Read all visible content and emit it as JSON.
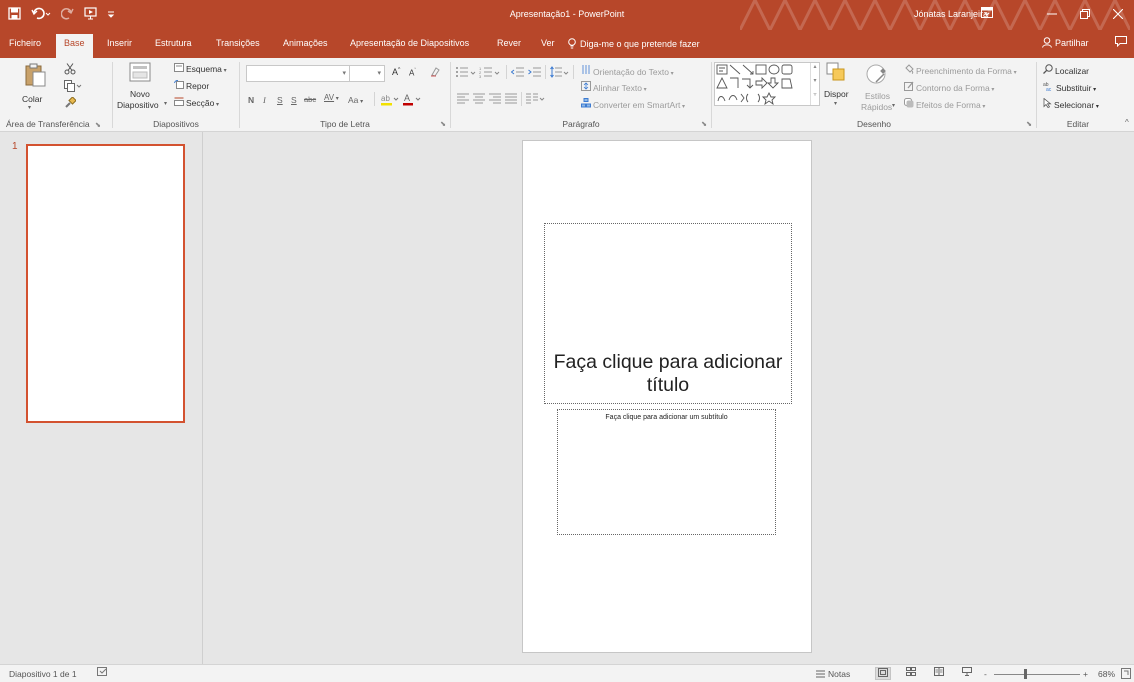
{
  "window": {
    "title": "Apresentação1 - PowerPoint",
    "user": "Jónatas Laranjeira",
    "icons": [
      "save-icon",
      "undo-icon",
      "redo-icon",
      "start-from-beginning-icon",
      "customize-qat-icon"
    ]
  },
  "tabs": [
    "Ficheiro",
    "Base",
    "Inserir",
    "Estrutura",
    "Transições",
    "Animações",
    "Apresentação de Diapositivos",
    "Rever",
    "Ver"
  ],
  "active_tab": "Base",
  "tell_me": "Diga-me o que pretende fazer",
  "share": "Partilhar",
  "ribbon": {
    "clipboard": {
      "label": "Área de Transferência",
      "paste": "Colar"
    },
    "slides": {
      "label": "Diapositivos",
      "new_slide_1": "Novo",
      "new_slide_2": "Diapositivo",
      "layout": "Esquema",
      "reset": "Repor",
      "section": "Secção"
    },
    "font": {
      "label": "Tipo de Letra",
      "font_name": "",
      "font_size": "",
      "bold": "N",
      "italic": "I",
      "underline": "S",
      "shadow": "S",
      "strike": "abc",
      "spacing": "AV",
      "case": "Aa",
      "grow": "A",
      "shrink": "A",
      "color": "A"
    },
    "paragraph": {
      "label": "Parágrafo",
      "text_direction": "Orientação do Texto",
      "align_text": "Alinhar Texto",
      "smartart": "Converter em SmartArt"
    },
    "drawing": {
      "label": "Desenho",
      "arrange": "Dispor",
      "quick_styles_1": "Estilos",
      "quick_styles_2": "Rápidos",
      "shape_fill": "Preenchimento da Forma",
      "shape_outline": "Contorno da Forma",
      "shape_effects": "Efeitos de Forma"
    },
    "editing": {
      "label": "Editar",
      "find": "Localizar",
      "replace": "Substituir",
      "select": "Selecionar"
    }
  },
  "thumbnails": [
    {
      "number": "1"
    }
  ],
  "slide": {
    "title_placeholder": "Faça clique para adicionar título",
    "subtitle_placeholder": "Faça clique para adicionar um subtítulo"
  },
  "status": {
    "slide_info": "Diapositivo 1 de 1",
    "notes": "Notas",
    "zoom_minus": "-",
    "zoom_plus": "+",
    "zoom": "68%"
  },
  "colors": {
    "accent": "#b7472a",
    "ribbon_bg": "#f3f3f3",
    "workspace_bg": "#e6e6e6"
  }
}
